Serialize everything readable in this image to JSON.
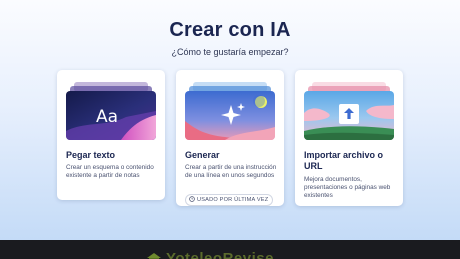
{
  "header": {
    "title": "Crear con IA",
    "subtitle": "¿Cómo te gustaría empezar?"
  },
  "cards": [
    {
      "title": "Pegar texto",
      "description": "Crear un esquema o contenido existente a partir de notas",
      "thumbnail_text": "Aa",
      "icon": "text-icon"
    },
    {
      "title": "Generar",
      "description": "Crear a partir de una instrucción de una línea en unos segundos",
      "badge": "USADO POR ÚLTIMA VEZ",
      "icon": "sparkle-icon"
    },
    {
      "title": "Importar archivo o URL",
      "description": "Mejora documentos, presentaciones o páginas web existentes",
      "icon": "upload-icon"
    }
  ],
  "footer": {
    "text": "YoteleoRevise"
  },
  "colors": {
    "title": "#1b2651",
    "footer_bg": "#1a1b1f",
    "footer_text": "#5b6b2c"
  }
}
